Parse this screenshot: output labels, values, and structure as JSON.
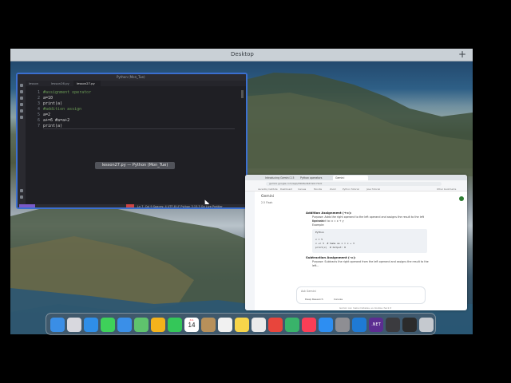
{
  "desktop": {
    "title": "Desktop",
    "add_label": "+"
  },
  "vscode": {
    "window_title": "Python (Mon_Tue)",
    "tabs": [
      "lesson",
      "lesson26.py",
      "lesson27.py"
    ],
    "line_numbers": [
      "1",
      "2",
      "3",
      "4",
      "5",
      "6",
      "7"
    ],
    "code_lines": [
      {
        "text": "#assignment operator",
        "kind": "comment"
      },
      {
        "text": "a=10",
        "kind": "code"
      },
      {
        "text": "print(a)",
        "kind": "code"
      },
      {
        "text": "#addition assign",
        "kind": "comment"
      },
      {
        "text": "a=2",
        "kind": "code"
      },
      {
        "text": "a+=6 #a=a+2",
        "kind": "code"
      },
      {
        "text": "print(a)",
        "kind": "cursor"
      }
    ],
    "tooltip": "lesson27.py — Python (Mon_Tue)",
    "status_text": "Ln 7, Col 9   Spaces: 4   UTF-8   LF   Python   3.13.3   Go Live   Prettier"
  },
  "browser": {
    "tabs": [
      "Introducing Gemini 2.5 Flash",
      "Python operators",
      "Gemini"
    ],
    "url": "gemini.google.com/app/d9b8e4b47a0c7bc0",
    "bookmarks": [
      "Ascentiq Institute",
      "Dashboard",
      "Canvas",
      "Moodle",
      "Zoom",
      "Python Tutorial",
      "Java Tutorial",
      "Other bookmarks"
    ],
    "app_name": "Gemini",
    "model": "2.5 Flash",
    "sections": [
      {
        "heading": "Addition Assignment (+=):",
        "lines": [
          "Purpose: Adds the right operand to the left operand and assigns the result to the left operand.",
          "Equivalent to: x = x + y",
          "Example:"
        ]
      },
      {
        "heading": "Subtraction Assignment (-=):",
        "lines": [
          "Purpose: Subtracts the right operand from the left operand and assigns the result to the left..."
        ]
      }
    ],
    "code_label": "Python",
    "code_lines": [
      "x = 5",
      "x += 3  # Same as x = x + 3",
      "print(x)  # Output: 8"
    ],
    "input_placeholder": "Ask Gemini",
    "input_options": [
      "Deep Research",
      "Canvas"
    ],
    "footer": "Gemini can make mistakes, so double-check it"
  },
  "dock": {
    "calendar_month": "JUL",
    "calendar_day": "14",
    "dotnet_label": ".NET",
    "apps": [
      {
        "name": "finder",
        "color": "#3a8ee6"
      },
      {
        "name": "launchpad",
        "color": "#d8d8de"
      },
      {
        "name": "safari",
        "color": "#2f8ee8"
      },
      {
        "name": "messages",
        "color": "#3ed15a"
      },
      {
        "name": "mail",
        "color": "#3a8fe8"
      },
      {
        "name": "maps",
        "color": "#5fc36d"
      },
      {
        "name": "photos",
        "color": "#f3b21c"
      },
      {
        "name": "facetime",
        "color": "#34c759"
      },
      {
        "name": "calendar",
        "color": "#ffffff"
      },
      {
        "name": "contacts",
        "color": "#b7905a"
      },
      {
        "name": "reminders",
        "color": "#f1f1f1"
      },
      {
        "name": "notes",
        "color": "#f7d54a"
      },
      {
        "name": "freeform",
        "color": "#eaeaea"
      },
      {
        "name": "chrome",
        "color": "#e8453c"
      },
      {
        "name": "pycharm",
        "color": "#39b36a"
      },
      {
        "name": "music",
        "color": "#fa3e56"
      },
      {
        "name": "app-store",
        "color": "#2d8ef2"
      },
      {
        "name": "settings",
        "color": "#8e8e93"
      },
      {
        "name": "vscode",
        "color": "#1f7ad4"
      },
      {
        "name": "dotnet",
        "color": "#5c2d91"
      },
      {
        "name": "quicktime",
        "color": "#3b3b3f"
      },
      {
        "name": "terminal",
        "color": "#2b2b2b"
      },
      {
        "name": "trash",
        "color": "#c5c9cf"
      }
    ]
  }
}
